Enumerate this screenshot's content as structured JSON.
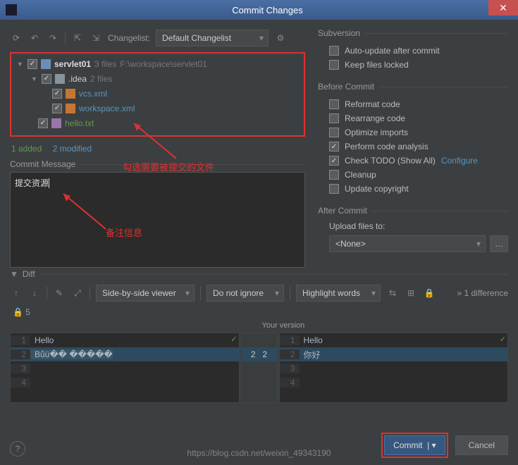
{
  "window": {
    "title": "Commit Changes"
  },
  "toolbar": {
    "changelist_label": "Changelist:",
    "changelist_value": "Default Changelist"
  },
  "tree": {
    "root": {
      "name": "servlet01",
      "meta": "3 files",
      "path": "F:\\workspace\\servlet01"
    },
    "idea": {
      "name": ".idea",
      "meta": "2 files"
    },
    "files": {
      "vcs": "vcs.xml",
      "workspace": "workspace.xml",
      "hello": "hello.txt"
    }
  },
  "status": {
    "added": "1 added",
    "modified": "2 modified"
  },
  "annotations": {
    "select_files": "勾选需要被提交的文件",
    "remark": "备注信息"
  },
  "commit_msg": {
    "label": "Commit Message",
    "value": "提交资源"
  },
  "subversion": {
    "title": "Subversion",
    "auto_update": "Auto-update after commit",
    "keep_locked": "Keep files locked"
  },
  "before_commit": {
    "title": "Before Commit",
    "reformat": "Reformat code",
    "rearrange": "Rearrange code",
    "optimize": "Optimize imports",
    "analysis": "Perform code analysis",
    "todo": "Check TODO (Show All)",
    "configure": "Configure",
    "cleanup": "Cleanup",
    "copyright": "Update copyright"
  },
  "after_commit": {
    "title": "After Commit",
    "upload_label": "Upload files to:",
    "upload_value": "<None>"
  },
  "diff": {
    "label": "Diff",
    "viewer": "Side-by-side viewer",
    "ignore": "Do not ignore",
    "highlight": "Highlight words",
    "differences": "1 difference",
    "count": "5",
    "your_version": "Your version",
    "left_lines": [
      "Hello",
      "Bůü��  �����"
    ],
    "right_lines": [
      "Hello",
      "你好"
    ]
  },
  "buttons": {
    "commit": "Commit",
    "cancel": "Cancel",
    "help": "?"
  },
  "watermark": "https://blog.csdn.net/weixin_49343190"
}
